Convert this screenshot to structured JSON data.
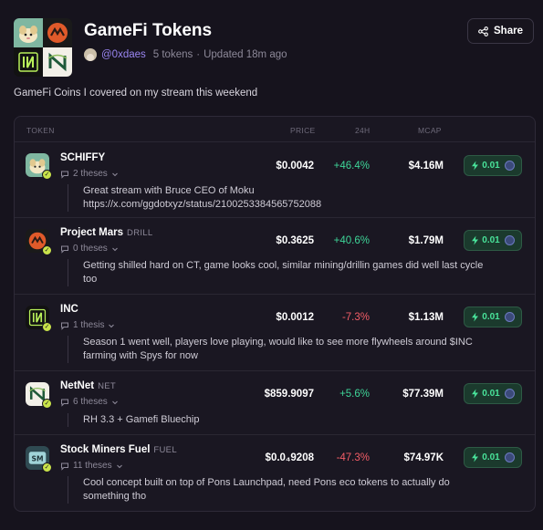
{
  "collection": {
    "title": "GameFi Tokens",
    "username": "@0xdaes",
    "token_count": "5 tokens",
    "updated": "Updated 18m ago",
    "description": "GameFi Coins I covered on my stream this weekend",
    "share_label": "Share"
  },
  "table": {
    "headers": {
      "token": "TOKEN",
      "price": "PRICE",
      "change": "24H",
      "mcap": "MCAP"
    },
    "rows": [
      {
        "name": "SCHIFFY",
        "ticker": "",
        "theses": "2 theses",
        "price": "$0.0042",
        "change": "+46.4%",
        "direction": "up",
        "mcap": "$4.16M",
        "tip": "0.01",
        "note": "Great stream with Bruce CEO of Moku\nhttps://x.com/ggdotxyz/status/2100253384565752088",
        "note_line1": "Great stream with Bruce CEO of Moku",
        "note_line2": "https://x.com/ggdotxyz/status/2100253384565752088"
      },
      {
        "name": "Project Mars",
        "ticker": "DRILL",
        "theses": "0 theses",
        "price": "$0.3625",
        "change": "+40.6%",
        "direction": "up",
        "mcap": "$1.79M",
        "tip": "0.01",
        "note_line1": "Getting shilled hard on CT, game looks cool, similar mining/drillin games did well last cycle",
        "note_line2": "too"
      },
      {
        "name": "INC",
        "ticker": "",
        "theses": "1 thesis",
        "price": "$0.0012",
        "change": "-7.3%",
        "direction": "down",
        "mcap": "$1.13M",
        "tip": "0.01",
        "note_line1": "Season 1 went well, players love playing, would like to see more flywheels around $INC",
        "note_line2": "farming with Spys for now"
      },
      {
        "name": "NetNet",
        "ticker": "NET",
        "theses": "6 theses",
        "price": "$859.9097",
        "change": "+5.6%",
        "direction": "up",
        "mcap": "$77.39M",
        "tip": "0.01",
        "note_line1": "RH 3.3 + Gamefi Bluechip",
        "note_line2": ""
      },
      {
        "name": "Stock Miners Fuel",
        "ticker": "FUEL",
        "theses": "11 theses",
        "price": "$0.0₄9208",
        "change": "-47.3%",
        "direction": "down",
        "mcap": "$74.97K",
        "tip": "0.01",
        "note_line1": "Cool concept built on top of Pons Launchpad, need Pons eco tokens to actually do",
        "note_line2": "something tho"
      }
    ]
  },
  "icons": {
    "share": "share-icon",
    "lightning": "lightning-icon",
    "chevron": "chevron-down-icon",
    "thesis": "thesis-bubble-icon",
    "verified": "verified-check-icon",
    "sol": "solana-icon"
  },
  "colors": {
    "accent_user": "#9a86f2",
    "up": "#3ed598",
    "down": "#f25d67",
    "tip_bg": "#1b3a2d",
    "tip_text": "#49e39a",
    "verified": "#c9e34a"
  }
}
